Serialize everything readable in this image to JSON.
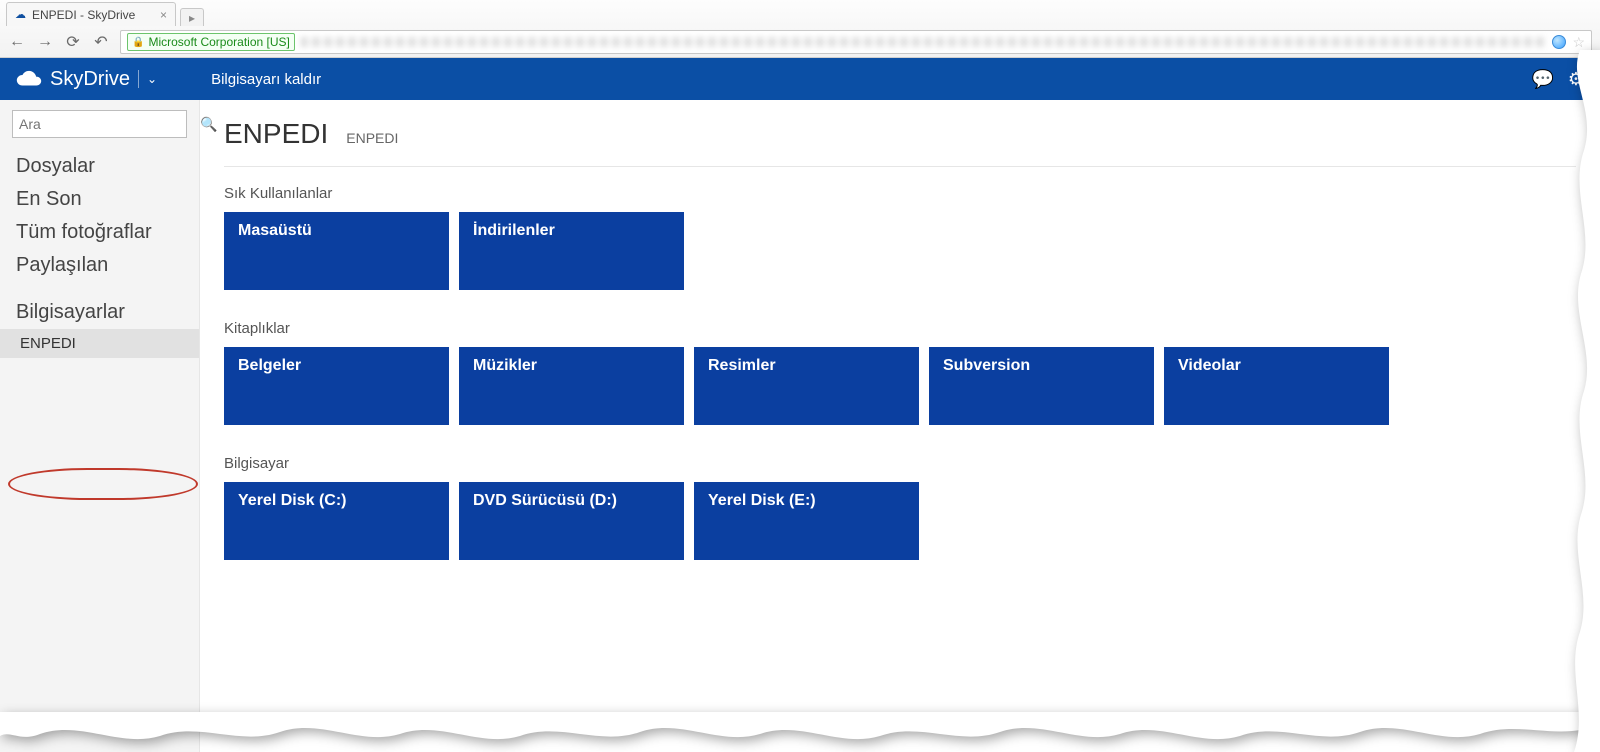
{
  "browser": {
    "tab_title": "ENPEDI - SkyDrive",
    "ssl_label": "Microsoft Corporation [US]"
  },
  "header": {
    "brand": "SkyDrive",
    "action": "Bilgisayarı kaldır"
  },
  "sidebar": {
    "search_placeholder": "Ara",
    "items": [
      {
        "label": "Dosyalar"
      },
      {
        "label": "En Son"
      },
      {
        "label": "Tüm fotoğraflar"
      },
      {
        "label": "Paylaşılan"
      }
    ],
    "computers_heading": "Bilgisayarlar",
    "computers": [
      {
        "label": "ENPEDI",
        "selected": true
      }
    ]
  },
  "page": {
    "title": "ENPEDI",
    "subtitle": "ENPEDI",
    "sections": [
      {
        "title": "Sık Kullanılanlar",
        "tiles": [
          "Masaüstü",
          "İndirilenler"
        ]
      },
      {
        "title": "Kitaplıklar",
        "tiles": [
          "Belgeler",
          "Müzikler",
          "Resimler",
          "Subversion",
          "Videolar"
        ]
      },
      {
        "title": "Bilgisayar",
        "tiles": [
          "Yerel Disk (C:)",
          "DVD Sürücüsü (D:)",
          "Yerel Disk (E:)"
        ]
      }
    ]
  }
}
